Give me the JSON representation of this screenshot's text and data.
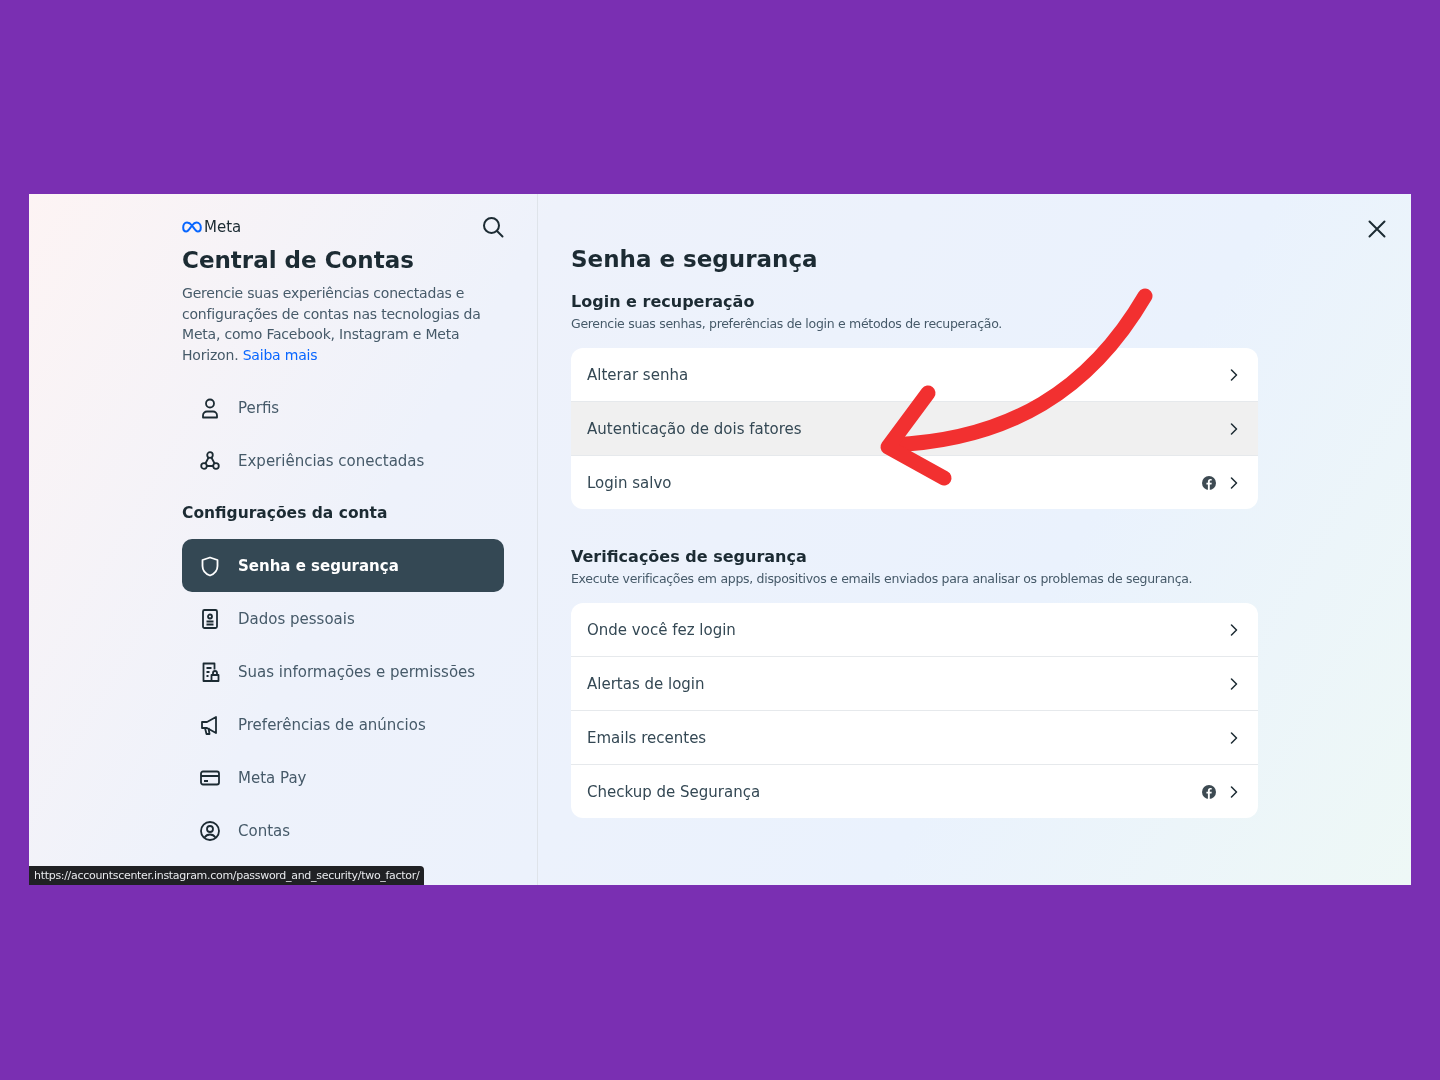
{
  "sidebar": {
    "brand": "Meta",
    "title": "Central de Contas",
    "description": "Gerencie suas experiências conectadas e configurações de contas nas tecnologias da Meta, como Facebook, Instagram e Meta Horizon.",
    "learn_more_link": "Saiba mais",
    "top_items": [
      {
        "kind": "person",
        "label": "Perfis",
        "selected": false
      },
      {
        "kind": "network",
        "label": "Experiências conectadas",
        "selected": false
      }
    ],
    "section_title": "Configurações da conta",
    "items": [
      {
        "kind": "shield",
        "label": "Senha e segurança",
        "selected": true
      },
      {
        "kind": "idcard",
        "label": "Dados pessoais",
        "selected": false
      },
      {
        "kind": "doclock",
        "label": "Suas informações e permissões",
        "selected": false
      },
      {
        "kind": "megaphone",
        "label": "Preferências de anúncios",
        "selected": false
      },
      {
        "kind": "card",
        "label": "Meta Pay",
        "selected": false
      },
      {
        "kind": "account",
        "label": "Contas",
        "selected": false
      }
    ]
  },
  "main": {
    "title": "Senha e segurança",
    "sections": [
      {
        "heading": "Login e recuperação",
        "subtitle": "Gerencie suas senhas, preferências de login e métodos de recuperação.",
        "rows": [
          {
            "label": "Alterar senha",
            "highlighted": false,
            "facebook_badge": false
          },
          {
            "label": "Autenticação de dois fatores",
            "highlighted": true,
            "facebook_badge": false
          },
          {
            "label": "Login salvo",
            "highlighted": false,
            "facebook_badge": true
          }
        ]
      },
      {
        "heading": "Verificações de segurança",
        "subtitle": "Execute verificações em apps, dispositivos e emails enviados para analisar os problemas de segurança.",
        "rows": [
          {
            "label": "Onde você fez login",
            "highlighted": false,
            "facebook_badge": false
          },
          {
            "label": "Alertas de login",
            "highlighted": false,
            "facebook_badge": false
          },
          {
            "label": "Emails recentes",
            "highlighted": false,
            "facebook_badge": false
          },
          {
            "label": "Checkup de Segurança",
            "highlighted": false,
            "facebook_badge": true
          }
        ]
      }
    ]
  },
  "status_bar": {
    "url": "https://accountscenter.instagram.com/password_and_security/two_factor/"
  }
}
